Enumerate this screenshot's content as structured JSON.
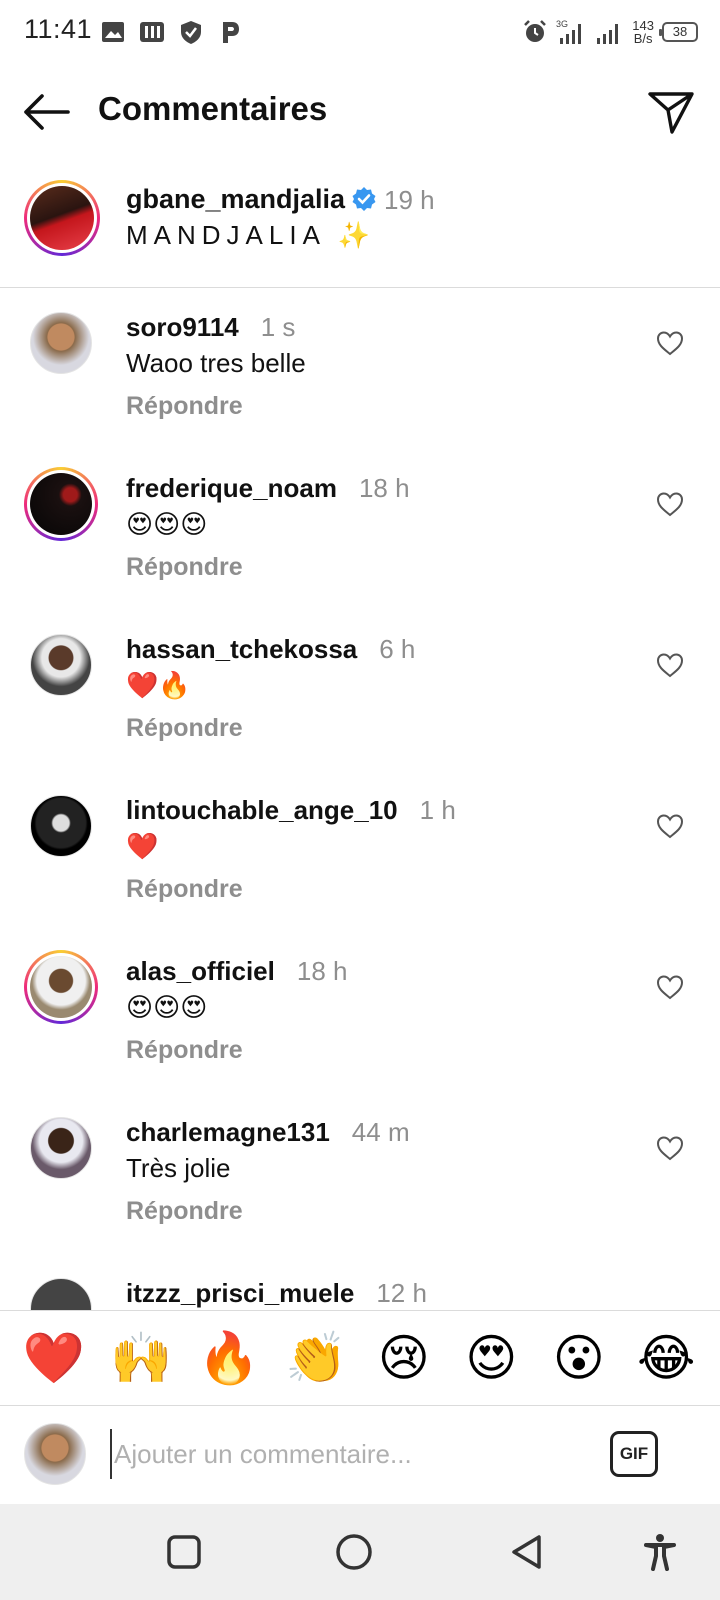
{
  "status_bar": {
    "time": "11:41",
    "net_speed_value": "143",
    "net_speed_unit": "B/s",
    "battery": "38"
  },
  "header": {
    "title": "Commentaires"
  },
  "caption": {
    "username": "gbane_mandjalia",
    "verified": true,
    "time": "19 h",
    "text": "MANDJALIA ✨"
  },
  "comments": [
    {
      "username": "soro9114",
      "time": "1 s",
      "text": "Waoo tres belle",
      "reply_label": "Répondre",
      "story_ring": false,
      "avatar_color": "#8a6a4a"
    },
    {
      "username": "frederique_noam",
      "time": "18 h",
      "text": "😍😍😍",
      "reply_label": "Répondre",
      "story_ring": true,
      "avatar_color": "#1a1010"
    },
    {
      "username": "hassan_tchekossa",
      "time": "6 h",
      "text": "❤️🔥",
      "reply_label": "Répondre",
      "story_ring": false,
      "avatar_color": "#6b6b6b"
    },
    {
      "username": "lintouchable_ange_10",
      "time": "1 h",
      "text": "❤️",
      "reply_label": "Répondre",
      "story_ring": false,
      "avatar_color": "#222222"
    },
    {
      "username": "alas_officiel",
      "time": "18 h",
      "text": "😍😍😍",
      "reply_label": "Répondre",
      "story_ring": true,
      "avatar_color": "#9a8a70"
    },
    {
      "username": "charlemagne131",
      "time": "44 m",
      "text": "Très jolie",
      "reply_label": "Répondre",
      "story_ring": false,
      "avatar_color": "#6a5a6a"
    },
    {
      "username": "itzzz_prisci_muele",
      "time": "12 h",
      "text": "",
      "reply_label": "",
      "story_ring": false,
      "avatar_color": "#444444"
    }
  ],
  "emoji_bar": [
    "❤️",
    "🙌",
    "🔥",
    "👏",
    "😢",
    "😍",
    "😮",
    "😂"
  ],
  "input": {
    "placeholder": "Ajouter un commentaire...",
    "value": "",
    "gif_label": "GIF"
  },
  "colors": {
    "secondary_text": "#8e8e8e",
    "verified_blue": "#3897f0",
    "divider": "#dbdbdb"
  },
  "icons": {
    "back": "arrow-left-icon",
    "send": "paper-plane-icon",
    "like": "heart-outline-icon",
    "nav": [
      "square-icon",
      "circle-icon",
      "triangle-back-icon",
      "accessibility-icon"
    ]
  }
}
